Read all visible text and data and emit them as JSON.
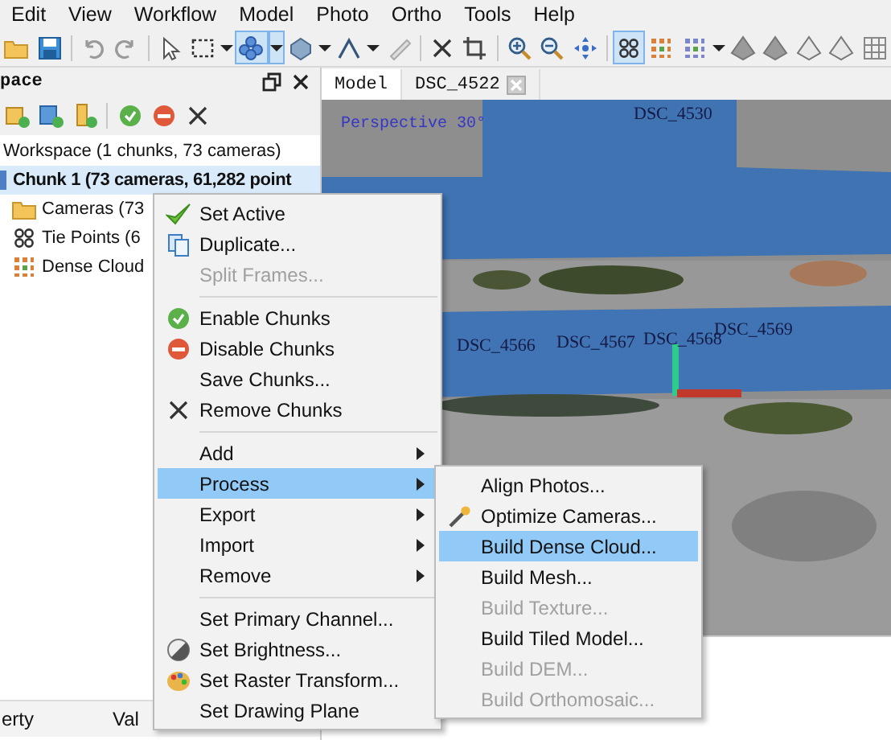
{
  "menu_bar": [
    "Edit",
    "View",
    "Workflow",
    "Model",
    "Photo",
    "Ortho",
    "Tools",
    "Help"
  ],
  "toolbar": [
    {
      "selected": false
    },
    {
      "selected": false
    },
    {
      "selected": false
    },
    {
      "selected": false
    },
    {
      "selected": false
    },
    {
      "selected": false
    },
    {
      "selected": false
    },
    {
      "selected": true
    },
    {
      "selected": true
    },
    {
      "selected": false
    },
    {
      "selected": false
    },
    {
      "selected": false
    },
    {
      "selected": false
    },
    {
      "selected": false
    },
    {
      "selected": false
    },
    {
      "selected": false
    },
    {
      "selected": false
    },
    {
      "selected": false
    },
    {
      "selected": false
    },
    {
      "selected": true
    },
    {
      "selected": false
    },
    {
      "selected": false
    },
    {
      "selected": false
    },
    {
      "selected": false
    },
    {
      "selected": false
    },
    {
      "selected": false
    },
    {
      "selected": false
    },
    {
      "selected": false
    }
  ],
  "workspace_panel": {
    "title": "pace",
    "tree": [
      {
        "label": "Workspace (1 chunks, 73 cameras)",
        "selected": false,
        "children": [
          {
            "label": "Chunk 1 (73 cameras, 61,282 point",
            "selected": true,
            "children": [
              {
                "label": "Cameras (73",
                "selected": false
              },
              {
                "label": "Tie Points (6",
                "selected": false
              },
              {
                "label": "Dense Cloud",
                "selected": false
              }
            ]
          }
        ]
      }
    ]
  },
  "properties_panel": {
    "columns": [
      "erty",
      "Val"
    ]
  },
  "viewer": {
    "tabs": [
      {
        "label": "Model",
        "selected": true,
        "closable": false
      },
      {
        "label": "DSC_4522",
        "selected": false,
        "closable": true
      }
    ],
    "projection": "Perspective 30°",
    "camera_labels": [
      "DSC_4530",
      "DSC_4566",
      "DSC_4567",
      "DSC_4568",
      "DSC_4569"
    ]
  },
  "context_menu": {
    "items": [
      {
        "kind": "item",
        "label": "Set Active",
        "disabled": false,
        "selected": false,
        "submenu": false
      },
      {
        "kind": "item",
        "label": "Duplicate...",
        "disabled": false,
        "selected": false,
        "submenu": false
      },
      {
        "kind": "item",
        "label": "Split Frames...",
        "disabled": true,
        "selected": false,
        "submenu": false
      },
      {
        "kind": "separator"
      },
      {
        "kind": "item",
        "label": "Enable Chunks",
        "disabled": false,
        "selected": false,
        "submenu": false
      },
      {
        "kind": "item",
        "label": "Disable Chunks",
        "disabled": false,
        "selected": false,
        "submenu": false
      },
      {
        "kind": "item",
        "label": "Save Chunks...",
        "disabled": false,
        "selected": false,
        "submenu": false
      },
      {
        "kind": "item",
        "label": "Remove Chunks",
        "disabled": false,
        "selected": false,
        "submenu": false
      },
      {
        "kind": "separator"
      },
      {
        "kind": "item",
        "label": "Add",
        "disabled": false,
        "selected": false,
        "submenu": true
      },
      {
        "kind": "item",
        "label": "Process",
        "disabled": false,
        "selected": true,
        "submenu": true
      },
      {
        "kind": "item",
        "label": "Export",
        "disabled": false,
        "selected": false,
        "submenu": true
      },
      {
        "kind": "item",
        "label": "Import",
        "disabled": false,
        "selected": false,
        "submenu": true
      },
      {
        "kind": "item",
        "label": "Remove",
        "disabled": false,
        "selected": false,
        "submenu": true
      },
      {
        "kind": "separator"
      },
      {
        "kind": "item",
        "label": "Set Primary Channel...",
        "disabled": false,
        "selected": false,
        "submenu": false
      },
      {
        "kind": "item",
        "label": "Set Brightness...",
        "disabled": false,
        "selected": false,
        "submenu": false
      },
      {
        "kind": "item",
        "label": "Set Raster Transform...",
        "disabled": false,
        "selected": false,
        "submenu": false
      },
      {
        "kind": "item",
        "label": "Set Drawing Plane",
        "disabled": false,
        "selected": false,
        "submenu": false
      }
    ]
  },
  "submenu": {
    "items": [
      {
        "kind": "item",
        "label": "Align Photos...",
        "disabled": false,
        "selected": false
      },
      {
        "kind": "item",
        "label": "Optimize Cameras...",
        "disabled": false,
        "selected": false
      },
      {
        "kind": "item",
        "label": "Build Dense Cloud...",
        "disabled": false,
        "selected": true
      },
      {
        "kind": "item",
        "label": "Build Mesh...",
        "disabled": false,
        "selected": false
      },
      {
        "kind": "item",
        "label": "Build Texture...",
        "disabled": true,
        "selected": false
      },
      {
        "kind": "item",
        "label": "Build Tiled Model...",
        "disabled": false,
        "selected": false
      },
      {
        "kind": "item",
        "label": "Build DEM...",
        "disabled": true,
        "selected": false
      },
      {
        "kind": "item",
        "label": "Build Orthomosaic...",
        "disabled": true,
        "selected": false
      }
    ]
  }
}
